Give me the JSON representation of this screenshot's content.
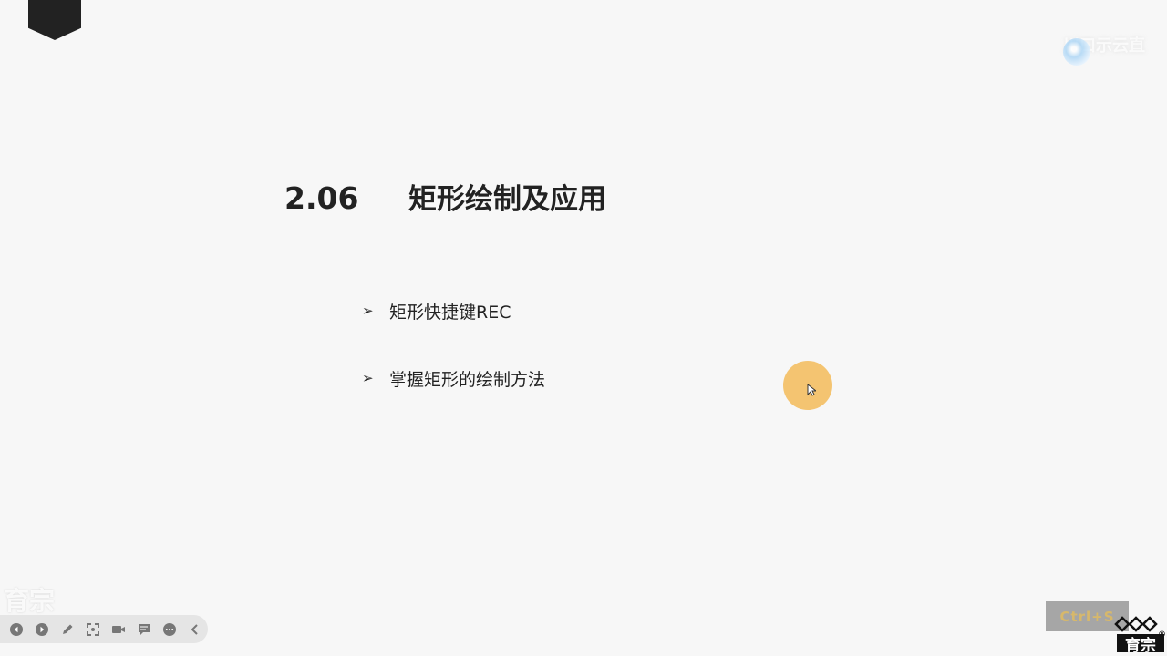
{
  "slide": {
    "number": "2.06",
    "title": "矩形绘制及应用",
    "bullets": [
      {
        "marker": "➢",
        "text": "矩形快捷键REC"
      },
      {
        "marker": "➢",
        "text": "掌握矩形的绘制方法"
      }
    ]
  },
  "watermarks": {
    "top": "川口示云直 ",
    "bottom": "育宗"
  },
  "toolbar": {
    "tools": [
      {
        "name": "previous-icon"
      },
      {
        "name": "next-icon"
      },
      {
        "name": "pen-icon"
      },
      {
        "name": "focus-icon"
      },
      {
        "name": "camera-icon"
      },
      {
        "name": "comment-icon"
      },
      {
        "name": "more-icon"
      },
      {
        "name": "collapse-icon"
      }
    ]
  },
  "shortcut_indicator": "Ctrl+S",
  "brand": {
    "name": "育宗",
    "registered": "®"
  },
  "colors": {
    "background": "#f7f7f7",
    "title": "#222222",
    "cursor_highlight": "#f4b64c",
    "toolbar": "#e5e5e5"
  }
}
